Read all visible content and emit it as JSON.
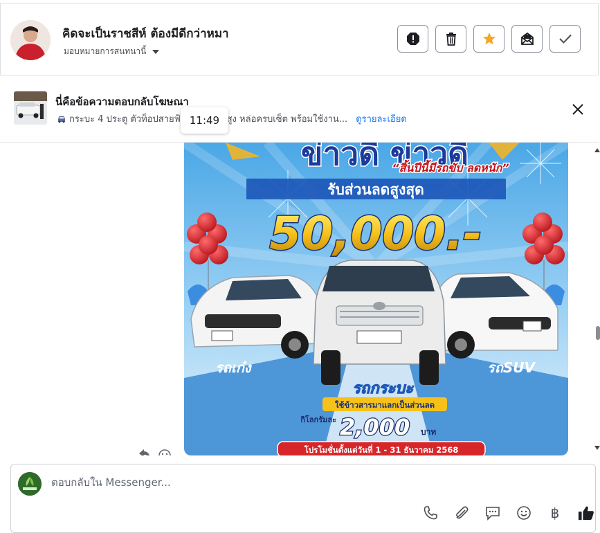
{
  "header": {
    "title": "คิดจะเป็นราชสีห์ ต้องมีดีกว่าหมา",
    "assign_label": "มอบหมายการสนทนานี้",
    "tools": [
      {
        "name": "spam-button",
        "icon": "exclamation-icon"
      },
      {
        "name": "delete-button",
        "icon": "trash-icon"
      },
      {
        "name": "star-button",
        "icon": "star-icon",
        "color": "#f5a623"
      },
      {
        "name": "move-to-inbox-button",
        "icon": "envelope-open-icon"
      },
      {
        "name": "mark-done-button",
        "icon": "check-icon"
      }
    ]
  },
  "ad_bar": {
    "title": "นี่คือข้อความตอบกลับโฆษณา",
    "description": "กระบะ 4 ประตู ตัวท็อปสายฟ้า",
    "description_end": "ยกสูง หล่อครบเซ็ต พร้อมใช้งาน...",
    "details_link": "ดูรายละเอียด"
  },
  "thread": {
    "timestamp": "11:49",
    "ad_image": {
      "headline": "ข่าวดี ข่าวดี",
      "slogan": "“สิ้นปีนี้มีรถขับ ลดหนัก”",
      "discount_label": "รับส่วนลดสูงสุด",
      "discount_amount": "50,000.-",
      "left_label": "รถเก๋ง",
      "right_label": "รถSUV",
      "center_label": "รถกระบะ",
      "rice_label": "ใช้ข้าวสารมาแลกเป็นส่วนลด",
      "rice_price_prefix": "กิโลกรัมละ",
      "rice_price": "2,000",
      "rice_price_unit": "บาท",
      "promo_dates": "โปรโมชั่นตั้งแต่วันที่  1 - 31  ธันวาคม  2568"
    }
  },
  "composer": {
    "placeholder": "ตอบกลับใน Messenger...",
    "baht_symbol": "฿"
  },
  "colors": {
    "accent_blue": "#1877f2",
    "star_orange": "#f5a623",
    "ad_sky": "#5fb5ea",
    "ad_red": "#d7262a",
    "ad_gold": "#f6c21a"
  }
}
